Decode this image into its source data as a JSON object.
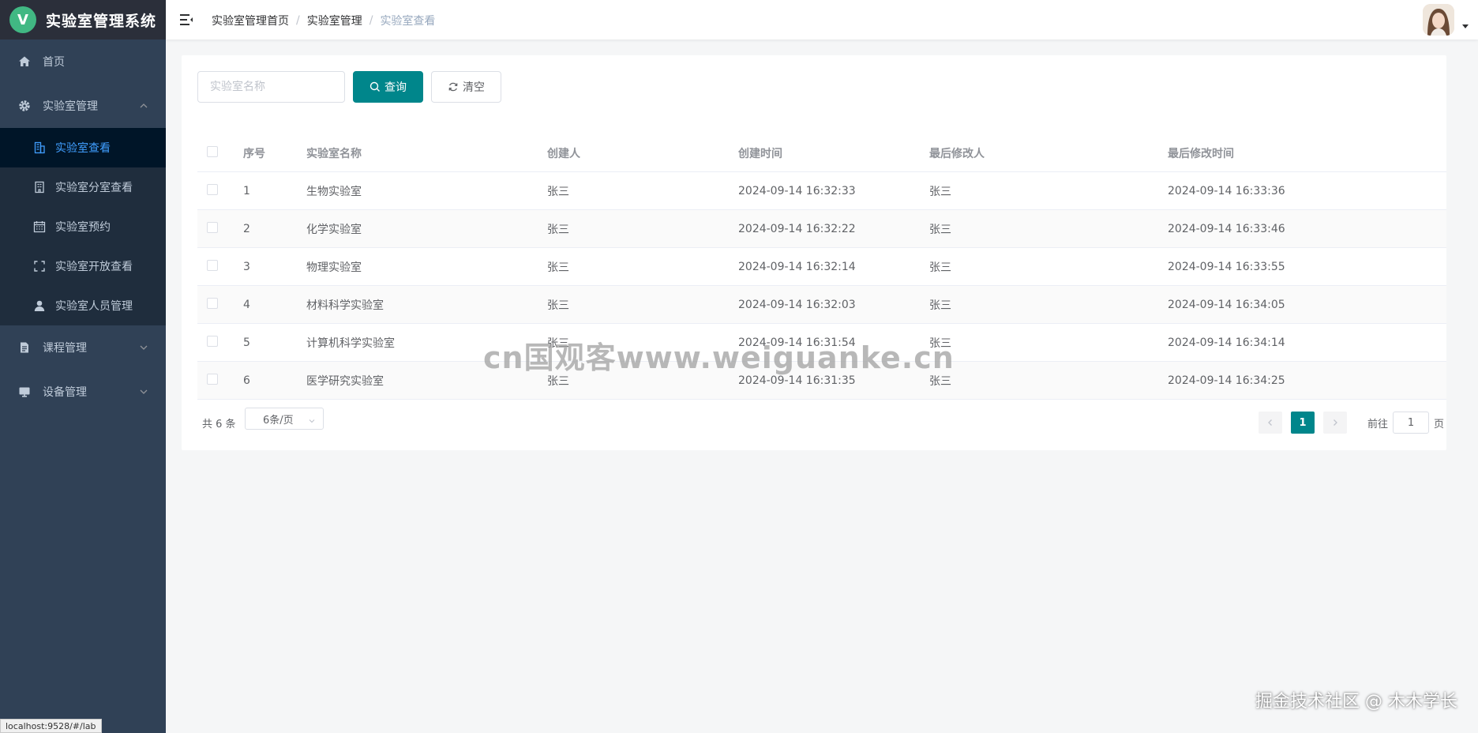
{
  "app": {
    "logo_letter": "V",
    "title": "实验室管理系统"
  },
  "sidebar": {
    "home": {
      "label": "首页",
      "icon": "home-icon"
    },
    "lab_management": {
      "label": "实验室管理",
      "icon": "gear-icon",
      "expanded": true,
      "children": [
        {
          "label": "实验室查看",
          "icon": "building-icon",
          "active": true
        },
        {
          "label": "实验室分室查看",
          "icon": "office-building-icon"
        },
        {
          "label": "实验室预约",
          "icon": "calendar-icon"
        },
        {
          "label": "实验室开放查看",
          "icon": "fullscreen-icon"
        },
        {
          "label": "实验室人员管理",
          "icon": "user-icon"
        }
      ]
    },
    "course_management": {
      "label": "课程管理",
      "icon": "document-icon"
    },
    "device_management": {
      "label": "设备管理",
      "icon": "monitor-icon"
    }
  },
  "breadcrumb": [
    "实验室管理首页",
    "实验室管理",
    "实验室查看"
  ],
  "search": {
    "placeholder": "实验室名称",
    "value": "",
    "query_label": "查询",
    "clear_label": "清空"
  },
  "table": {
    "columns": [
      "序号",
      "实验室名称",
      "创建人",
      "创建时间",
      "最后修改人",
      "最后修改时间"
    ],
    "rows": [
      {
        "idx": "1",
        "name": "生物实验室",
        "creator": "张三",
        "created": "2024-09-14 16:32:33",
        "modifier": "张三",
        "modified": "2024-09-14 16:33:36"
      },
      {
        "idx": "2",
        "name": "化学实验室",
        "creator": "张三",
        "created": "2024-09-14 16:32:22",
        "modifier": "张三",
        "modified": "2024-09-14 16:33:46"
      },
      {
        "idx": "3",
        "name": "物理实验室",
        "creator": "张三",
        "created": "2024-09-14 16:32:14",
        "modifier": "张三",
        "modified": "2024-09-14 16:33:55"
      },
      {
        "idx": "4",
        "name": "材料科学实验室",
        "creator": "张三",
        "created": "2024-09-14 16:32:03",
        "modifier": "张三",
        "modified": "2024-09-14 16:34:05"
      },
      {
        "idx": "5",
        "name": "计算机科学实验室",
        "creator": "张三",
        "created": "2024-09-14 16:31:54",
        "modifier": "张三",
        "modified": "2024-09-14 16:34:14"
      },
      {
        "idx": "6",
        "name": "医学研究实验室",
        "creator": "张三",
        "created": "2024-09-14 16:31:35",
        "modifier": "张三",
        "modified": "2024-09-14 16:34:25"
      }
    ]
  },
  "pagination": {
    "total_text": "共 6 条",
    "page_size": "6条/页",
    "current_page": "1",
    "goto_label": "前往",
    "goto_value": "1",
    "goto_unit": "页"
  },
  "overlay": {
    "watermark": "cn国观客www.weiguanke.cn",
    "credit": "掘金技术社区 @ 木木学长",
    "status_url": "localhost:9528/#/lab"
  },
  "colors": {
    "sidebar_bg": "#304156",
    "submenu_bg": "#1f2d3d",
    "active_submenu_bg": "#001528",
    "active_text": "#409eff",
    "primary": "#00868b",
    "logo_badge": "#41b883"
  }
}
